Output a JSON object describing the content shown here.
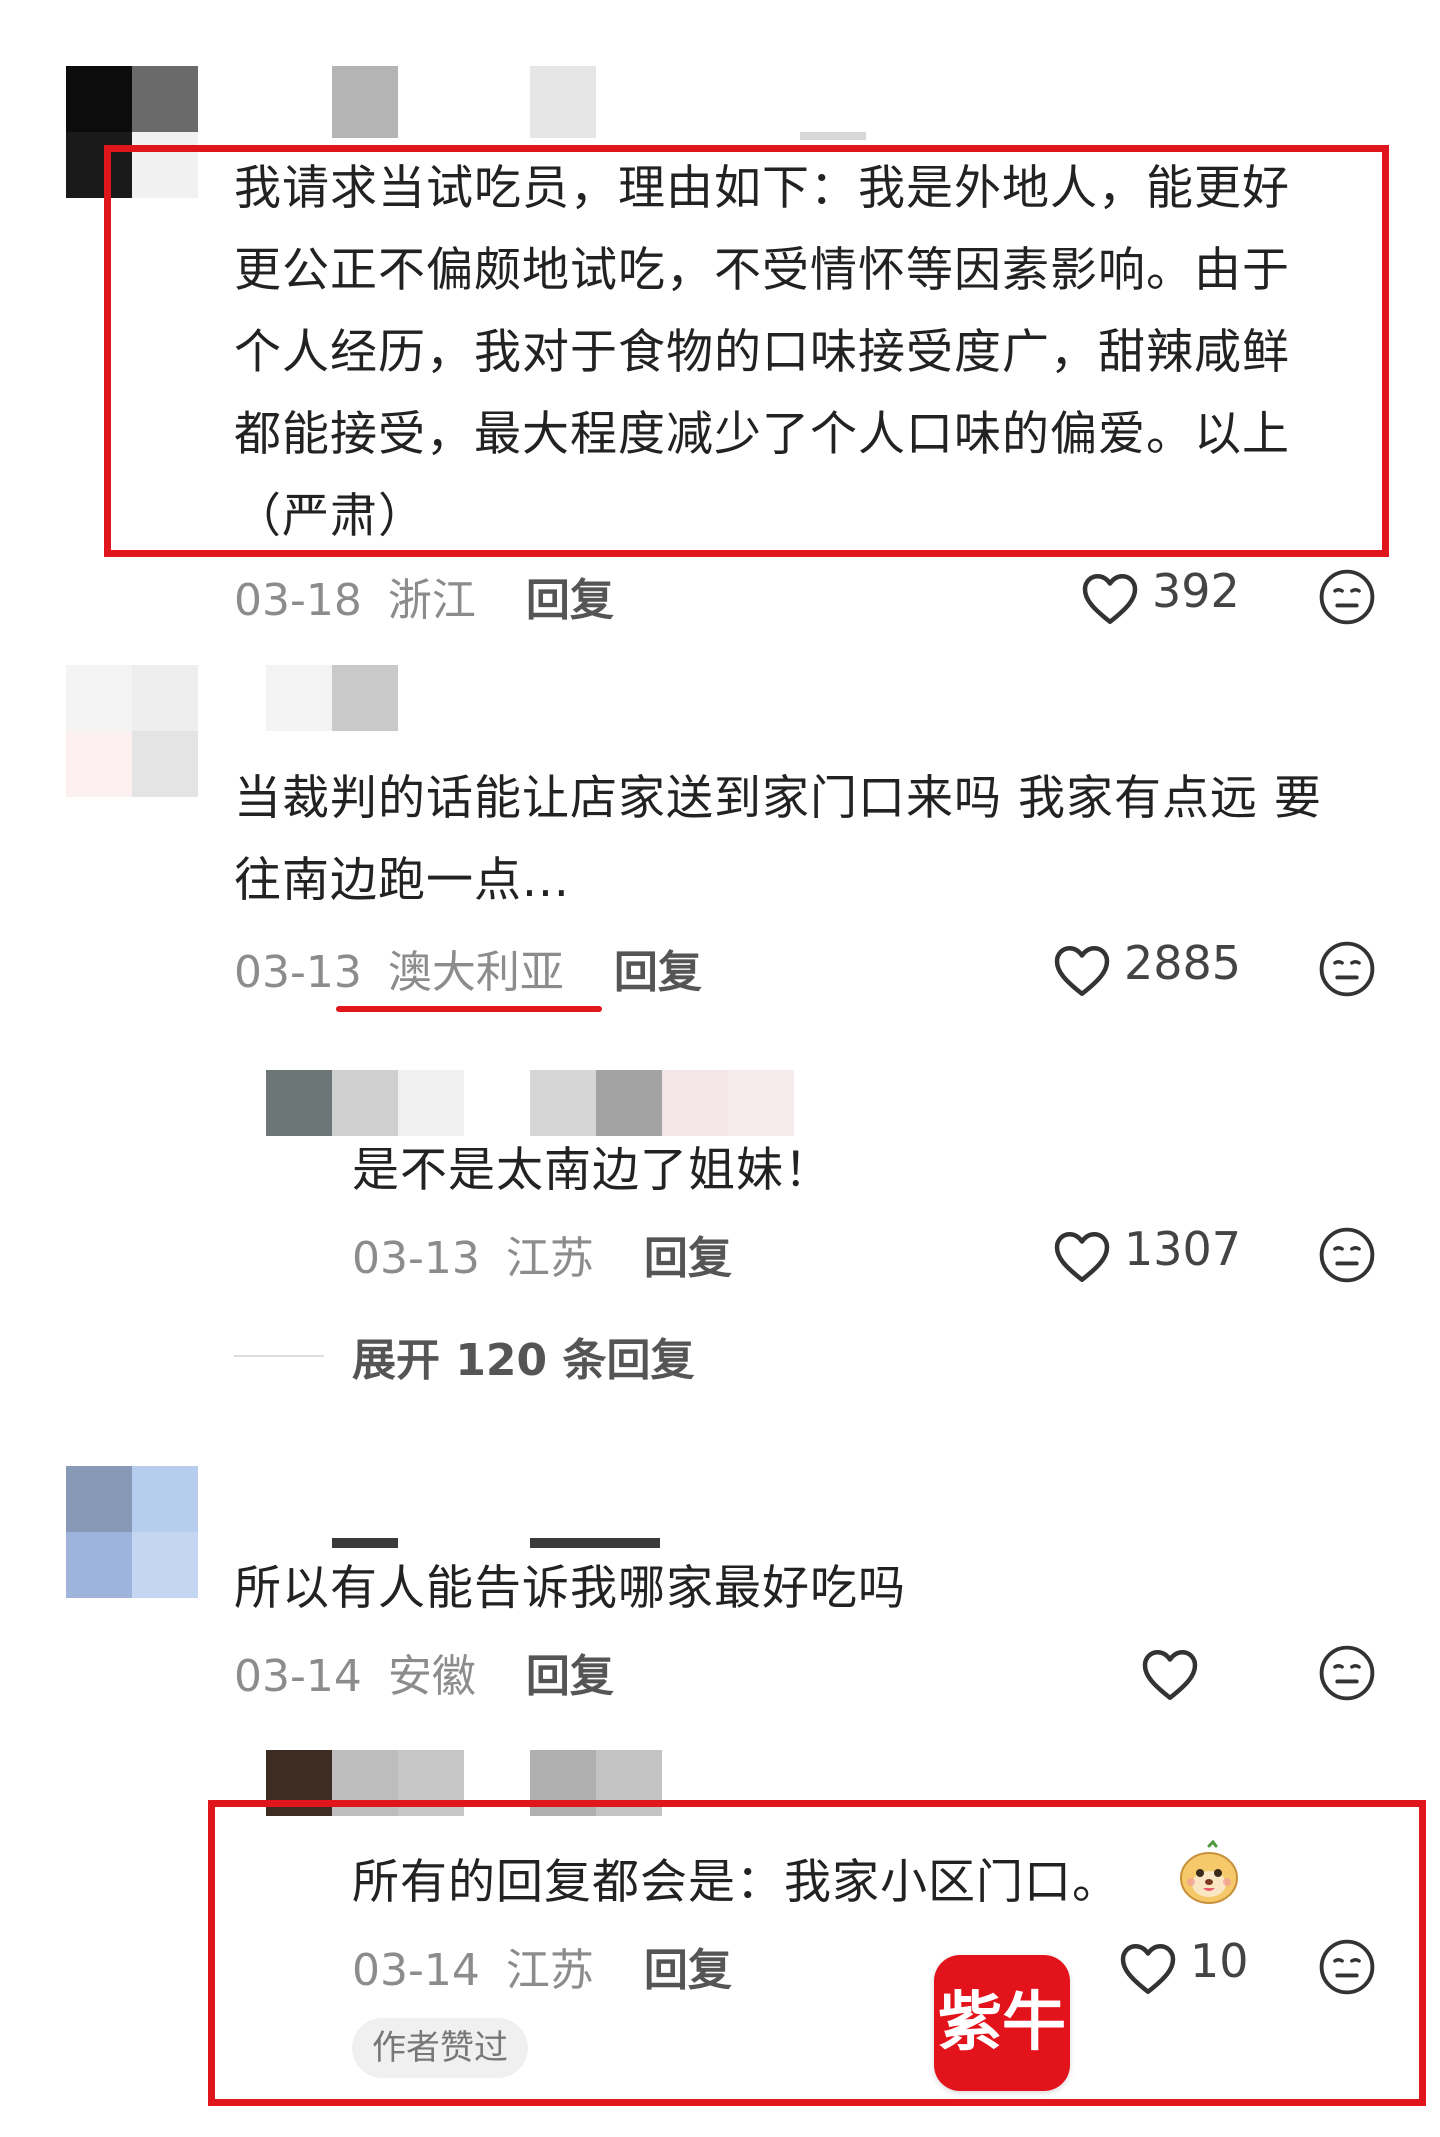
{
  "colors": {
    "highlight": "#e0161c",
    "text": "#222222",
    "meta": "#8c8c8c",
    "logo_bg": "#e3131c"
  },
  "comments": [
    {
      "text_lines": [
        "我请求当试吃员，理由如下：我是外地人，能更好",
        "更公正不偏颇地试吃，不受情怀等因素影响。由于",
        "个人经历，我对于食物的口味接受度广，甜辣咸鲜",
        "都能接受，最大程度减少了个人口味的偏爱。以上",
        "（严肃）"
      ],
      "date": "03-18",
      "location": "浙江",
      "reply_label": "回复",
      "likes": "392"
    },
    {
      "text_lines": [
        "当裁判的话能让店家送到家门口来吗 我家有点远 要",
        "往南边跑一点..."
      ],
      "date": "03-13",
      "location": "澳大利亚",
      "reply_label": "回复",
      "likes": "2885"
    },
    {
      "text": "是不是太南边了姐妹！",
      "date": "03-13",
      "location": "江苏",
      "reply_label": "回复",
      "likes": "1307"
    },
    {
      "text": "所以有人能告诉我哪家最好吃吗",
      "date": "03-14",
      "location": "安徽",
      "reply_label": "回复",
      "likes": ""
    },
    {
      "text": "所有的回复都会是：我家小区门口。",
      "date": "03-14",
      "location": "江苏",
      "reply_label": "回复",
      "likes": "10",
      "badge": "作者赞过"
    }
  ],
  "expand_replies": "展开 120 条回复",
  "logo_text": "紫牛",
  "icons": {
    "like": "heart-icon",
    "dislike": "neutral-face-icon",
    "emoji": "cartoon-face-emoji-icon"
  }
}
